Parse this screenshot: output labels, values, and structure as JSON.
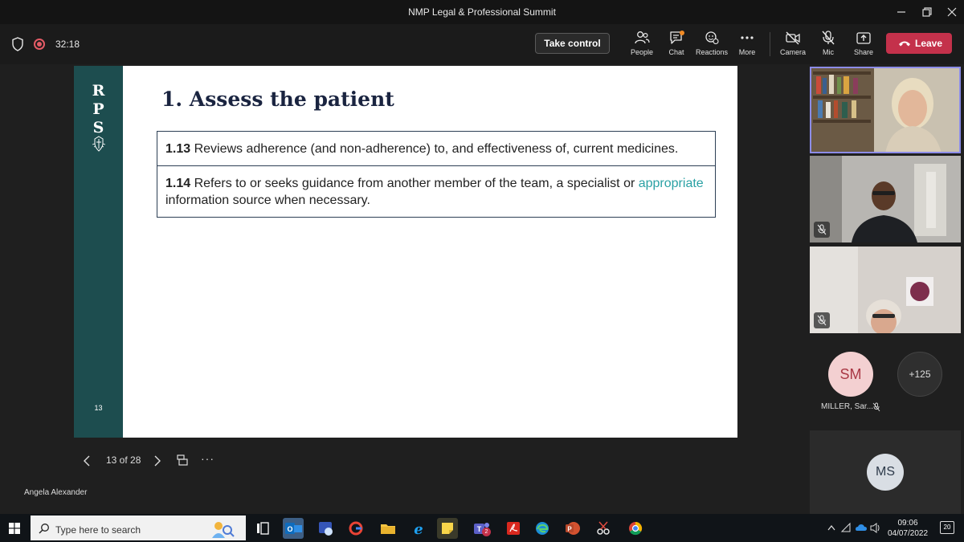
{
  "window": {
    "title": "NMP Legal & Professional Summit"
  },
  "toolbar": {
    "timer": "32:18",
    "take_control": "Take control",
    "buttons": {
      "people": "People",
      "chat": "Chat",
      "reactions": "Reactions",
      "more": "More",
      "camera": "Camera",
      "mic": "Mic",
      "share": "Share"
    },
    "leave": "Leave"
  },
  "slide": {
    "band_letters": "R\nP\nS",
    "number": "13",
    "title": "1. Assess the patient",
    "criteria": [
      {
        "num": "1.13",
        "text_before": " Reviews adherence (and non-adherence) to, and effectiveness of, current medicines.",
        "highlight": "",
        "text_after": ""
      },
      {
        "num": "1.14",
        "text_before": " Refers to or seeks guidance from another member of the team, a specialist or ",
        "highlight": "appropriate",
        "text_after": " information source when necessary."
      }
    ],
    "highlight_color": "#2aa1a4",
    "band_color": "#1d4d4f"
  },
  "slide_nav": {
    "position": "13 of 28",
    "more": "···"
  },
  "presenter": "Angela Alexander",
  "participants": {
    "tile_initials": "SM",
    "overflow": "+125",
    "tile_name": "MILLER, Sar...",
    "self_initials": "MS",
    "avatar_color": "#f3d0d1"
  },
  "taskbar": {
    "search_placeholder": "Type here to search",
    "time": "09:06",
    "date": "04/07/2022",
    "notifications": "20",
    "teams_badge": "2"
  },
  "colors": {
    "leave": "#c4314b",
    "accent": "#8c8ce8"
  }
}
